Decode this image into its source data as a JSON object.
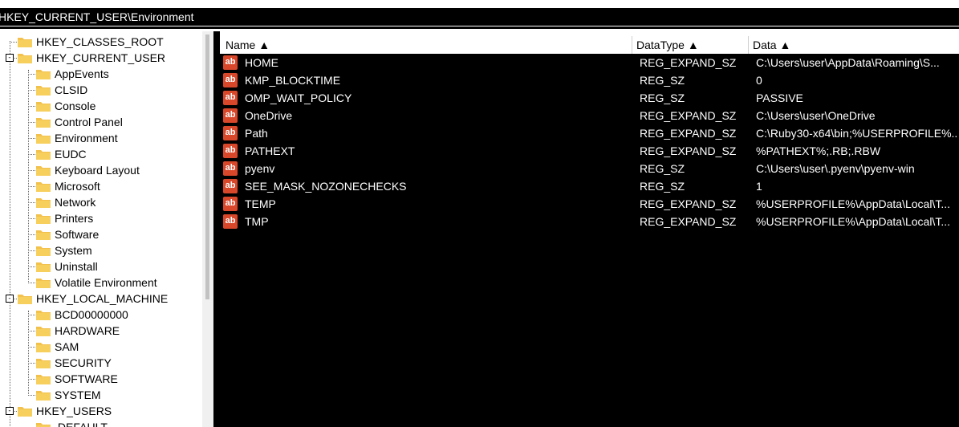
{
  "window": {
    "title_fragment": ""
  },
  "address_bar": {
    "path": "HKEY_CURRENT_USER\\Environment"
  },
  "tree": {
    "items": [
      {
        "label": "HKEY_CLASSES_ROOT",
        "level": 0,
        "expander": ""
      },
      {
        "label": "HKEY_CURRENT_USER",
        "level": 0,
        "expander": "-"
      },
      {
        "label": "AppEvents",
        "level": 1,
        "expander": ""
      },
      {
        "label": "CLSID",
        "level": 1,
        "expander": ""
      },
      {
        "label": "Console",
        "level": 1,
        "expander": ""
      },
      {
        "label": "Control Panel",
        "level": 1,
        "expander": ""
      },
      {
        "label": "Environment",
        "level": 1,
        "expander": ""
      },
      {
        "label": "EUDC",
        "level": 1,
        "expander": ""
      },
      {
        "label": "Keyboard Layout",
        "level": 1,
        "expander": ""
      },
      {
        "label": "Microsoft",
        "level": 1,
        "expander": ""
      },
      {
        "label": "Network",
        "level": 1,
        "expander": ""
      },
      {
        "label": "Printers",
        "level": 1,
        "expander": ""
      },
      {
        "label": "Software",
        "level": 1,
        "expander": ""
      },
      {
        "label": "System",
        "level": 1,
        "expander": ""
      },
      {
        "label": "Uninstall",
        "level": 1,
        "expander": ""
      },
      {
        "label": "Volatile Environment",
        "level": 1,
        "expander": ""
      },
      {
        "label": "HKEY_LOCAL_MACHINE",
        "level": 0,
        "expander": "-"
      },
      {
        "label": "BCD00000000",
        "level": 1,
        "expander": ""
      },
      {
        "label": "HARDWARE",
        "level": 1,
        "expander": ""
      },
      {
        "label": "SAM",
        "level": 1,
        "expander": ""
      },
      {
        "label": "SECURITY",
        "level": 1,
        "expander": ""
      },
      {
        "label": "SOFTWARE",
        "level": 1,
        "expander": ""
      },
      {
        "label": "SYSTEM",
        "level": 1,
        "expander": ""
      },
      {
        "label": "HKEY_USERS",
        "level": 0,
        "expander": "-"
      },
      {
        "label": ".DEFAULT",
        "level": 1,
        "expander": ""
      }
    ]
  },
  "list": {
    "columns": [
      {
        "label": "Name ▲"
      },
      {
        "label": "DataType ▲"
      },
      {
        "label": "Data ▲"
      }
    ],
    "icon_text": "ab",
    "rows": [
      {
        "name": "HOME",
        "type": "REG_EXPAND_SZ",
        "data": "C:\\Users\\user\\AppData\\Roaming\\S..."
      },
      {
        "name": "KMP_BLOCKTIME",
        "type": "REG_SZ",
        "data": "0"
      },
      {
        "name": "OMP_WAIT_POLICY",
        "type": "REG_SZ",
        "data": "PASSIVE"
      },
      {
        "name": "OneDrive",
        "type": "REG_EXPAND_SZ",
        "data": "C:\\Users\\user\\OneDrive"
      },
      {
        "name": "Path",
        "type": "REG_EXPAND_SZ",
        "data": "C:\\Ruby30-x64\\bin;%USERPROFILE%..."
      },
      {
        "name": "PATHEXT",
        "type": "REG_EXPAND_SZ",
        "data": "%PATHEXT%;.RB;.RBW"
      },
      {
        "name": "pyenv",
        "type": "REG_SZ",
        "data": "C:\\Users\\user\\.pyenv\\pyenv-win"
      },
      {
        "name": "SEE_MASK_NOZONECHECKS",
        "type": "REG_SZ",
        "data": "1"
      },
      {
        "name": "TEMP",
        "type": "REG_EXPAND_SZ",
        "data": "%USERPROFILE%\\AppData\\Local\\T..."
      },
      {
        "name": "TMP",
        "type": "REG_EXPAND_SZ",
        "data": "%USERPROFILE%\\AppData\\Local\\T..."
      }
    ]
  },
  "colors": {
    "folder": "#f2c14e",
    "icon": "#d9472b",
    "background": "#000000"
  }
}
